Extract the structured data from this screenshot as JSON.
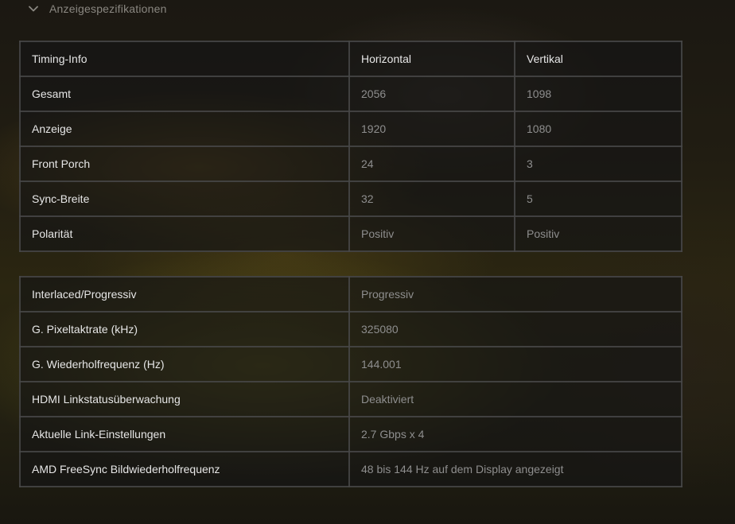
{
  "section": {
    "title": "Anzeigespezifikationen",
    "chevron_icon": "chevron-down-icon"
  },
  "timing_table": {
    "headers": [
      "Timing-Info",
      "Horizontal",
      "Vertikal"
    ],
    "rows": [
      {
        "label": "Gesamt",
        "horizontal": "2056",
        "vertical": "1098"
      },
      {
        "label": "Anzeige",
        "horizontal": "1920",
        "vertical": "1080"
      },
      {
        "label": "Front Porch",
        "horizontal": "24",
        "vertical": "3"
      },
      {
        "label": "Sync-Breite",
        "horizontal": "32",
        "vertical": "5"
      },
      {
        "label": "Polarität",
        "horizontal": "Positiv",
        "vertical": "Positiv"
      }
    ]
  },
  "info_table": {
    "rows": [
      {
        "label": "Interlaced/Progressiv",
        "value": "Progressiv"
      },
      {
        "label": "G. Pixeltaktrate (kHz)",
        "value": "325080"
      },
      {
        "label": "G. Wiederholfrequenz (Hz)",
        "value": "144.001"
      },
      {
        "label": "HDMI Linkstatusüberwachung",
        "value": "Deaktiviert"
      },
      {
        "label": "Aktuelle Link-Einstellungen",
        "value": "2.7 Gbps x 4"
      },
      {
        "label": "AMD FreeSync Bildwiederholfrequenz",
        "value": "48 bis 144 Hz auf dem Display angezeigt"
      }
    ]
  },
  "colors": {
    "label_text": "#e6e6e6",
    "value_text": "#8e8e8e",
    "border": "#484848"
  }
}
